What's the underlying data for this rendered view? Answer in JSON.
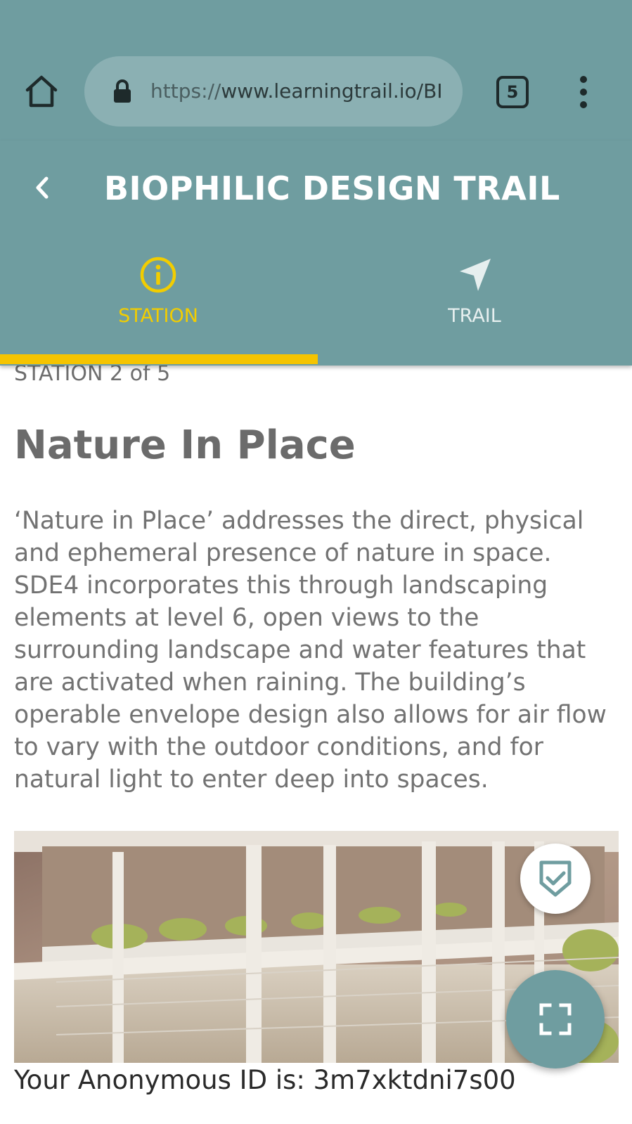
{
  "browser": {
    "url_scheme": "https://",
    "url_rest": "www.learningtrail.io/BI",
    "tab_count": "5",
    "icons": {
      "home": "home-icon",
      "lock": "lock-icon",
      "menu": "more-vert-icon"
    }
  },
  "header": {
    "title": "BIOPHILIC DESIGN TRAIL",
    "back_icon": "chevron-left-icon",
    "background_color": "#6f9da0"
  },
  "tabs": [
    {
      "label": "STATION",
      "icon": "info-icon",
      "active": true,
      "color": "#f2cd00"
    },
    {
      "label": "TRAIL",
      "icon": "navigation-arrow-icon",
      "active": false,
      "color": "#e6efef"
    }
  ],
  "station": {
    "counter": "STATION 2 of 5",
    "title": "Nature In Place",
    "description": "‘Nature in Place’ addresses the direct, physical and ephemeral presence of nature in space. SDE4 incorporates this through landscaping elements at level 6, open views to the surrounding landscape and water features that are activated when raining. The building’s operable envelope design also allows for air flow to vary with the outdoor conditions, and for natural light to enter deep into spaces."
  },
  "image": {
    "subject": "architectural model of building with planted terraces"
  },
  "actions": {
    "check_icon": "shield-check-icon",
    "fullscreen_icon": "fullscreen-icon"
  },
  "footer": {
    "anonymous_id": "Your Anonymous ID is: 3m7xktdni7s00"
  }
}
